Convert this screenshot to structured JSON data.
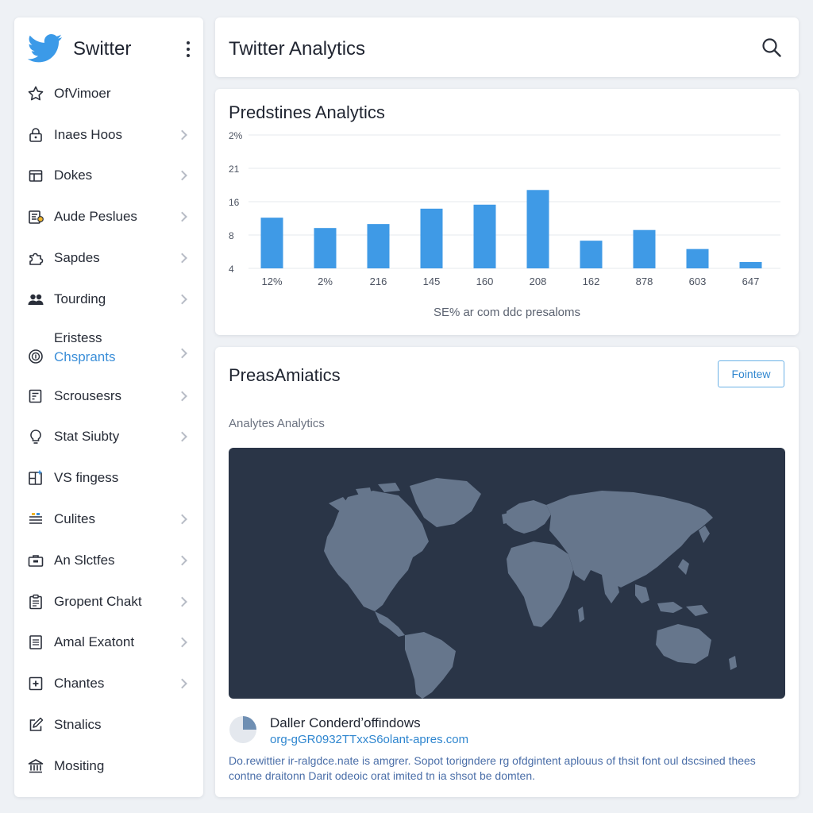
{
  "sidebar": {
    "brand": "Switter",
    "items": [
      {
        "label": "OfVimoer",
        "icon": "star-icon",
        "chevron": false
      },
      {
        "label": "Inaes Hoos",
        "icon": "lock-icon",
        "chevron": true
      },
      {
        "label": "Dokes",
        "icon": "box-icon",
        "chevron": true
      },
      {
        "label": "Aude Peslues",
        "icon": "document-badge-icon",
        "chevron": true
      },
      {
        "label": "Sapdes",
        "icon": "puzzle-icon",
        "chevron": true
      },
      {
        "label": "Tourding",
        "icon": "users-icon",
        "chevron": true
      },
      {
        "label": "Eristess",
        "sublabel": "Chsprants",
        "icon": "coin-icon",
        "chevron": true
      },
      {
        "label": "Scrousesrs",
        "icon": "form-icon",
        "chevron": true
      },
      {
        "label": "Stat Siubty",
        "icon": "lightbulb-icon",
        "chevron": true
      },
      {
        "label": "VS fingess",
        "icon": "split-panel-icon",
        "chevron": false
      },
      {
        "label": "Culites",
        "icon": "stack-icon",
        "chevron": true
      },
      {
        "label": "An Slctfes",
        "icon": "briefcase-icon",
        "chevron": true
      },
      {
        "label": "Gropent Chakt",
        "icon": "clipboard-icon",
        "chevron": true
      },
      {
        "label": "Amal Exatont",
        "icon": "page-icon",
        "chevron": true
      },
      {
        "label": "Chantes",
        "icon": "plus-square-icon",
        "chevron": true
      },
      {
        "label": "Stnalics",
        "icon": "edit-icon",
        "chevron": false
      },
      {
        "label": "Mositing",
        "icon": "bank-icon",
        "chevron": false
      }
    ]
  },
  "header": {
    "title": "Twitter Analytics",
    "search_icon": "search-icon"
  },
  "chart_card": {
    "title": "Predstines Analytics",
    "caption": "SE% ar com ddc presaloms"
  },
  "chart_data": {
    "type": "bar",
    "title": "Predstines Analytics",
    "xlabel": "SE% ar com ddc presaloms",
    "ylabel": "",
    "y_ticks": [
      "2%",
      "21",
      "16",
      "8",
      "4"
    ],
    "categories": [
      "12%",
      "2%",
      "216",
      "145",
      "160",
      "208",
      "162",
      "878",
      "603",
      "647"
    ],
    "values": [
      15.2,
      12.1,
      13.3,
      17.9,
      19.1,
      23.5,
      8.3,
      11.5,
      5.8,
      1.9
    ],
    "ylim": [
      0,
      40
    ],
    "grid": true,
    "color": "#3f9ae6"
  },
  "map_card": {
    "title": "PreasAmiatics",
    "button_label": "Fointew",
    "subtitle": "Analytes Analytics",
    "footer_title": "Daller Conderdʼoffindows",
    "footer_link": "org-gGR0932TTxxS6olant-apres.com",
    "footer_description": "Do.rewittier ir-ralgdce.nate is amgrer. Sopot torigndere rg ofdgintent aplouus of thsit font oul dscsined thees contne draitonn Darit odeoic orat imited tn ia shsot be domten.",
    "map_color": "#2a3547",
    "land_color": "#66768c"
  }
}
